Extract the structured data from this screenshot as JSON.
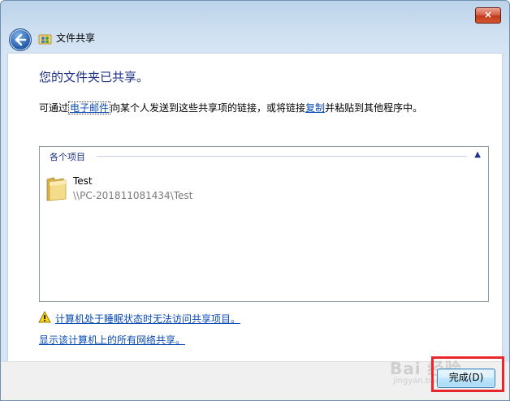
{
  "window": {
    "title": "文件共享",
    "close_label": "×"
  },
  "content": {
    "heading": "您的文件夹已共享。",
    "desc_prefix": "可通过",
    "desc_email_link": "电子邮件",
    "desc_middle": "向某个人发送到这些共享项的链接，或将链接",
    "desc_copy_link": "复制",
    "desc_suffix": "并粘贴到其他程序中。"
  },
  "list": {
    "group_header": "各个项目",
    "items": [
      {
        "name": "Test",
        "path": "\\\\PC-201811081434\\Test"
      }
    ]
  },
  "links": {
    "sleep_warning": "计算机处于睡眠状态时无法访问共享项目。",
    "show_network_shares": "显示该计算机上的所有网络共享。"
  },
  "footer": {
    "finish_label": "完成(D)"
  },
  "watermark": {
    "main": "Bai 经验",
    "sub": "jingyan.baidu.com"
  },
  "colors": {
    "heading": "#1e3287",
    "link": "#0a4bb4",
    "highlight": "#e8262b"
  }
}
